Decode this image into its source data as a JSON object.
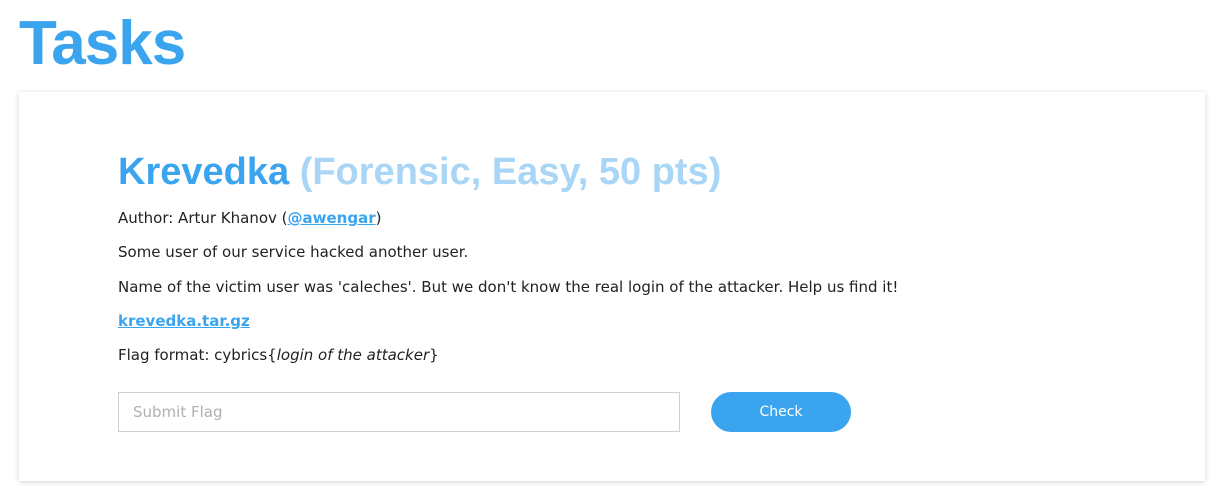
{
  "page": {
    "title": "Tasks"
  },
  "task": {
    "name": "Krevedka",
    "meta": "(Forensic, Easy, 50 pts)",
    "author_prefix": "Author: Artur Khanov (",
    "author_handle": "@awengar",
    "author_suffix": ")",
    "description_1": "Some user of our service hacked another user.",
    "description_2": "Name of the victim user was 'caleches'. But we don't know the real login of the attacker. Help us find it!",
    "file_link": "krevedka.tar.gz",
    "flag_format_prefix": "Flag format: cybrics{",
    "flag_format_placeholder": "login of the attacker",
    "flag_format_suffix": "}"
  },
  "form": {
    "flag_placeholder": "Submit Flag",
    "check_label": "Check"
  },
  "colors": {
    "accent": "#3aa4ef",
    "accent_light": "#a9d6f7"
  }
}
